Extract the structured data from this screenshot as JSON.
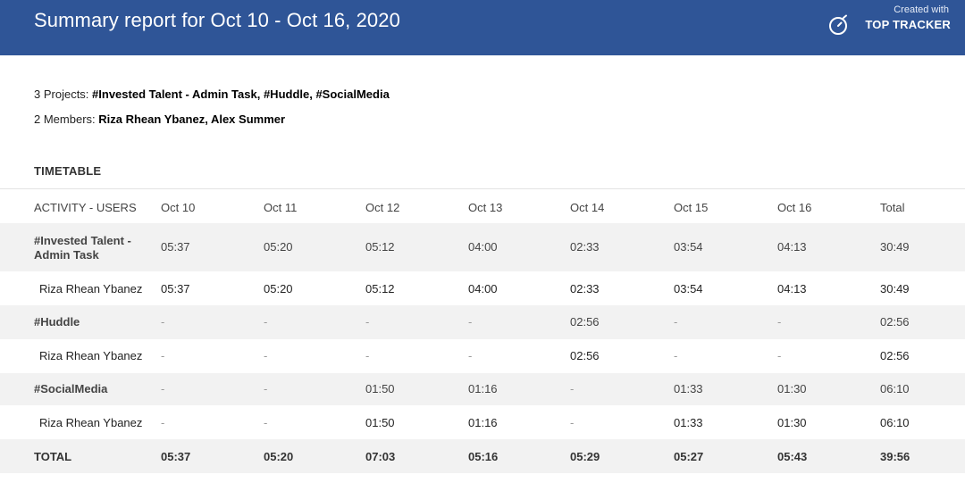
{
  "header": {
    "title": "Summary report for Oct 10 - Oct 16, 2020",
    "brand_caption": "Created with",
    "brand_name": "TOP TRACKER",
    "brand_color": "#2f5597"
  },
  "meta": {
    "projects_prefix": "3 Projects: ",
    "projects_value": "#Invested Talent - Admin Task, #Huddle, #SocialMedia",
    "members_prefix": "2 Members: ",
    "members_value": "Riza Rhean Ybanez, Alex Summer"
  },
  "timetable": {
    "title": "TIMETABLE",
    "columns": [
      "ACTIVITY - USERS",
      "Oct 10",
      "Oct 11",
      "Oct 12",
      "Oct 13",
      "Oct 14",
      "Oct 15",
      "Oct 16",
      "Total"
    ],
    "rows": [
      {
        "kind": "project",
        "label": "#Invested Talent - Admin Task",
        "label_line1": "#Invested Talent -",
        "label_line2": "Admin Task",
        "values": [
          "05:37",
          "05:20",
          "05:12",
          "04:00",
          "02:33",
          "03:54",
          "04:13",
          "30:49"
        ]
      },
      {
        "kind": "user",
        "label": "Riza Rhean Ybanez",
        "values": [
          "05:37",
          "05:20",
          "05:12",
          "04:00",
          "02:33",
          "03:54",
          "04:13",
          "30:49"
        ]
      },
      {
        "kind": "project",
        "label": "#Huddle",
        "values": [
          "-",
          "-",
          "-",
          "-",
          "02:56",
          "-",
          "-",
          "02:56"
        ]
      },
      {
        "kind": "user",
        "label": "Riza Rhean Ybanez",
        "values": [
          "-",
          "-",
          "-",
          "-",
          "02:56",
          "-",
          "-",
          "02:56"
        ]
      },
      {
        "kind": "project",
        "label": "#SocialMedia",
        "values": [
          "-",
          "-",
          "01:50",
          "01:16",
          "-",
          "01:33",
          "01:30",
          "06:10"
        ]
      },
      {
        "kind": "user",
        "label": "Riza Rhean Ybanez",
        "values": [
          "-",
          "-",
          "01:50",
          "01:16",
          "-",
          "01:33",
          "01:30",
          "06:10"
        ]
      },
      {
        "kind": "total",
        "label": "TOTAL",
        "values": [
          "05:37",
          "05:20",
          "07:03",
          "05:16",
          "05:29",
          "05:27",
          "05:43",
          "39:56"
        ]
      }
    ]
  }
}
